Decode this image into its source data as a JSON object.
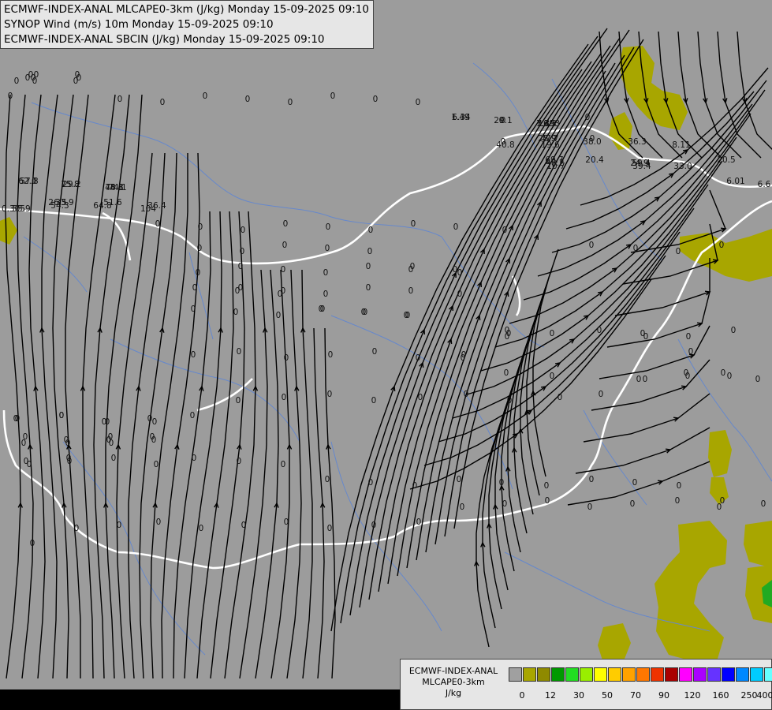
{
  "titles": [
    "ECMWF-INDEX-ANAL MLCAPE0-3km (J/kg) Monday 15-09-2025 09:10",
    "SYNOP Wind (m/s) 10m Monday 15-09-2025 09:10",
    "ECMWF-INDEX-ANAL SBCIN (J/kg) Monday 15-09-2025 09:10"
  ],
  "legend": {
    "line1": "ECMWF-INDEX-ANAL",
    "line2": "MLCAPE0-3km",
    "line3": "J/kg",
    "ticks": [
      "0",
      "12",
      "30",
      "50",
      "70",
      "90",
      "120",
      "160",
      "250",
      "400"
    ],
    "colors": [
      "#a0a0a0",
      "#a8a600",
      "#8f8a00",
      "#009900",
      "#22dd22",
      "#99ee00",
      "#ffff00",
      "#ffcc00",
      "#ffa200",
      "#ff7700",
      "#ee3300",
      "#aa0000",
      "#ff00ff",
      "#aa00ff",
      "#6633ff",
      "#0000ff",
      "#0088ff",
      "#00ccff",
      "#66ffff",
      "#ffffff"
    ]
  },
  "colors": {
    "land": "#9c9c9c",
    "cape_fill": "#a8a600",
    "cape_high": "#22aa22",
    "rivers": "#6688cc",
    "borders": "#ffffff"
  },
  "values": [
    [
      "0",
      "46"
    ],
    [
      "0",
      "100"
    ],
    [
      "0",
      "44"
    ],
    [
      "0",
      "98"
    ],
    [
      "0",
      "42"
    ],
    [
      "0",
      "96"
    ],
    [
      "0",
      "39"
    ],
    [
      "0",
      "35"
    ],
    [
      "0",
      "21"
    ],
    [
      "0",
      "13"
    ],
    [
      "0",
      "152"
    ],
    [
      "0",
      "206"
    ],
    [
      "0",
      "260"
    ],
    [
      "0",
      "314"
    ],
    [
      "0",
      "368"
    ],
    [
      "0",
      "422"
    ],
    [
      "0",
      "476"
    ],
    [
      "0",
      "530"
    ],
    [
      "1.49",
      "584"
    ],
    [
      "0",
      "636"
    ],
    [
      "1.793",
      "695"
    ],
    [
      "0",
      "745"
    ],
    [
      "29.1",
      "638"
    ],
    [
      "7.35",
      "692"
    ],
    [
      "6.34",
      "585"
    ],
    [
      "0",
      "638"
    ],
    [
      "16.3",
      "694"
    ],
    [
      "25.9",
      "694"
    ],
    [
      "0",
      "638"
    ],
    [
      "40.8",
      "641"
    ],
    [
      "47.7",
      "697"
    ],
    [
      "38.0",
      "751"
    ],
    [
      "19.6",
      "698"
    ],
    [
      "0",
      "751"
    ],
    [
      "36.3",
      "808"
    ],
    [
      "8.11",
      "864"
    ],
    [
      "20.4",
      "754"
    ],
    [
      "24.9",
      "811"
    ],
    [
      "33.0",
      "866"
    ],
    [
      "20.5",
      "921"
    ],
    [
      "59.4",
      "813"
    ],
    [
      "39.4",
      "814"
    ],
    [
      "69.7",
      "703"
    ],
    [
      "48.2",
      "704"
    ],
    [
      "10.7",
      "705"
    ],
    [
      "6.01",
      "933"
    ],
    [
      "6.6",
      "969"
    ],
    [
      "74.1",
      "149"
    ],
    [
      "57.8",
      "37"
    ],
    [
      "29.2",
      "91"
    ],
    [
      "48.1",
      "145"
    ],
    [
      "62.0",
      "35"
    ],
    [
      "75.8",
      "89"
    ],
    [
      "74.8",
      "145"
    ],
    [
      "51.6",
      "143"
    ],
    [
      "36.4",
      "199"
    ],
    [
      "55.9",
      "27"
    ],
    [
      "33.9",
      "82"
    ],
    [
      "54.3",
      "76"
    ],
    [
      "0.305",
      "17"
    ],
    [
      "26.5",
      "73"
    ],
    [
      "64.8",
      "130"
    ],
    [
      "104",
      "188"
    ],
    [
      "0",
      "200"
    ],
    [
      "0",
      "254"
    ],
    [
      "0",
      "308"
    ],
    [
      "0",
      "362"
    ],
    [
      "0",
      "416"
    ],
    [
      "0",
      "470"
    ],
    [
      "0",
      "524"
    ],
    [
      "0",
      "578"
    ],
    [
      "0",
      "640"
    ],
    [
      "0",
      "750"
    ],
    [
      "0",
      "806"
    ],
    [
      "0",
      "860"
    ],
    [
      "0",
      "915"
    ],
    [
      "0",
      "253"
    ],
    [
      "0",
      "307"
    ],
    [
      "0",
      "361"
    ],
    [
      "0",
      "415"
    ],
    [
      "0",
      "469"
    ],
    [
      "0",
      "523"
    ],
    [
      "0",
      "577"
    ],
    [
      "0",
      "251"
    ],
    [
      "0",
      "305"
    ],
    [
      "0",
      "359"
    ],
    [
      "0",
      "413"
    ],
    [
      "0",
      "467"
    ],
    [
      "0",
      "521"
    ],
    [
      "0",
      "583"
    ],
    [
      "0",
      "305"
    ],
    [
      "0",
      "359"
    ],
    [
      "0",
      "413"
    ],
    [
      "0",
      "467"
    ],
    [
      "0",
      "521"
    ],
    [
      "0",
      "583"
    ],
    [
      "0",
      "247"
    ],
    [
      "0",
      "301"
    ],
    [
      "0",
      "355"
    ],
    [
      "0",
      "409"
    ],
    [
      "0",
      "463"
    ],
    [
      "0",
      "517"
    ],
    [
      "0",
      "245"
    ],
    [
      "0",
      "299"
    ],
    [
      "0",
      "353"
    ],
    [
      "0",
      "407"
    ],
    [
      "0",
      "461"
    ],
    [
      "0",
      "515"
    ],
    [
      "0",
      "643"
    ],
    [
      "0",
      "700"
    ],
    [
      "0",
      "643"
    ],
    [
      "0",
      "760"
    ],
    [
      "0",
      "815"
    ],
    [
      "0",
      "873"
    ],
    [
      "0",
      "930"
    ],
    [
      "0",
      "645"
    ],
    [
      "0",
      "819"
    ],
    [
      "0",
      "876"
    ],
    [
      "0",
      "588"
    ],
    [
      "0",
      "530"
    ],
    [
      "0",
      "475"
    ],
    [
      "0",
      "419"
    ],
    [
      "0",
      "363"
    ],
    [
      "0",
      "303"
    ],
    [
      "0",
      "245"
    ],
    [
      "0",
      "587"
    ],
    [
      "0",
      "642"
    ],
    [
      "0",
      "700"
    ],
    [
      "0",
      "810"
    ],
    [
      "0",
      "870"
    ],
    [
      "0",
      "925"
    ],
    [
      "0",
      "961"
    ],
    [
      "0",
      "917"
    ],
    [
      "0",
      "872"
    ],
    [
      "0",
      "818"
    ],
    [
      "0",
      "762"
    ],
    [
      "0",
      "710"
    ],
    [
      "0",
      "646"
    ],
    [
      "0",
      "591"
    ],
    [
      "0",
      "533"
    ],
    [
      "0",
      "474"
    ],
    [
      "0",
      "418"
    ],
    [
      "0",
      "360"
    ],
    [
      "0",
      "302"
    ],
    [
      "0",
      "244"
    ],
    [
      "0",
      "190"
    ],
    [
      "0",
      "136"
    ],
    [
      "0",
      "78"
    ],
    [
      "0",
      "20"
    ],
    [
      "0",
      "132"
    ],
    [
      "0",
      "78"
    ],
    [
      "0",
      "22"
    ],
    [
      "0",
      "196"
    ],
    [
      "0",
      "140"
    ],
    [
      "0",
      "84"
    ],
    [
      "0",
      "30"
    ],
    [
      "0",
      "193"
    ],
    [
      "0",
      "138"
    ],
    [
      "0",
      "86"
    ],
    [
      "0",
      "32"
    ],
    [
      "0",
      "195"
    ],
    [
      "0",
      "141"
    ],
    [
      "0",
      "87"
    ],
    [
      "0",
      "33"
    ],
    [
      "0",
      "198"
    ],
    [
      "0",
      "144"
    ],
    [
      "0",
      "88"
    ],
    [
      "0",
      "37"
    ],
    [
      "0",
      "246"
    ],
    [
      "0",
      "303"
    ],
    [
      "0",
      "359"
    ],
    [
      "0",
      "415"
    ],
    [
      "0",
      "470"
    ],
    [
      "0",
      "526"
    ],
    [
      "0",
      "582"
    ],
    [
      "0",
      "636"
    ],
    [
      "0",
      "693"
    ],
    [
      "0",
      "750"
    ],
    [
      "0",
      "805"
    ],
    [
      "0",
      "861"
    ],
    [
      "0",
      "916"
    ],
    [
      "0",
      "968"
    ],
    [
      "0",
      "912"
    ],
    [
      "0",
      "859"
    ],
    [
      "0",
      "802"
    ],
    [
      "0",
      "748"
    ],
    [
      "0",
      "694"
    ],
    [
      "0",
      "640"
    ],
    [
      "0",
      "586"
    ],
    [
      "0",
      "531"
    ],
    [
      "0",
      "474"
    ],
    [
      "0",
      "418"
    ],
    [
      "0",
      "363"
    ],
    [
      "0",
      "309"
    ],
    [
      "0",
      "255"
    ],
    [
      "0",
      "201"
    ],
    [
      "0",
      "151"
    ],
    [
      "0",
      "97"
    ],
    [
      "0",
      "41"
    ]
  ]
}
